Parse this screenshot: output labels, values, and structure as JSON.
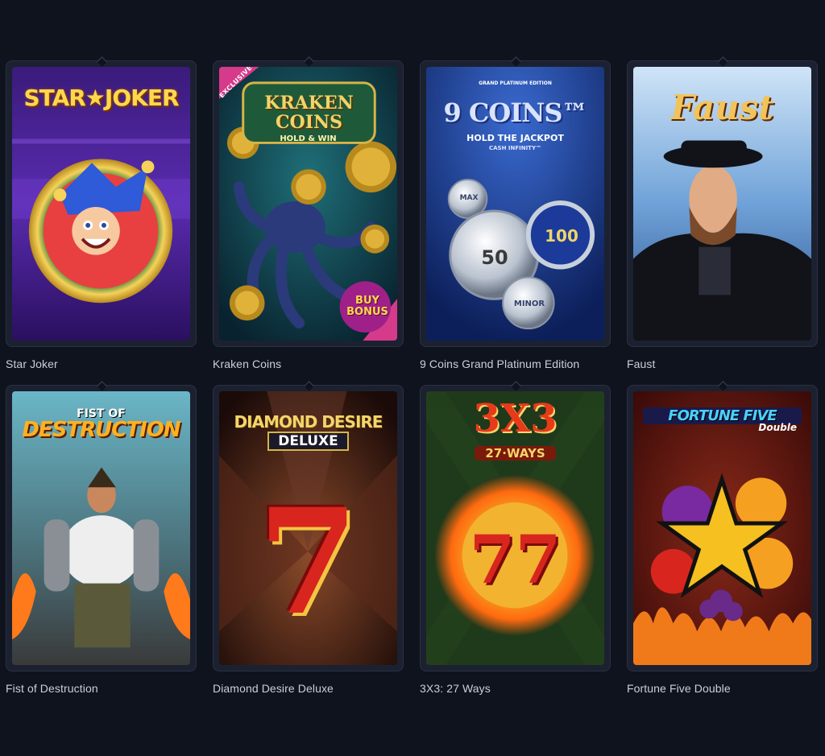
{
  "games": [
    {
      "title": "Star Joker",
      "logo_text": "STAR★JOKER",
      "icon": "jester-icon"
    },
    {
      "title": "Kraken Coins",
      "logo_text": "KRAKEN COINS",
      "logo_sub": "HOLD & WIN",
      "badge": "EXCLUSIVE",
      "bonus_text": "BUY BONUS",
      "icon": "octopus-icon"
    },
    {
      "title": "9 Coins Grand Platinum Edition",
      "logo_top": "GRAND PLATINUM EDITION",
      "logo_text": "9 COINS™",
      "logo_sub": "HOLD THE JACKPOT",
      "logo_sub2": "CASH INFINITY™",
      "coin_values": [
        "MAX",
        "50",
        "100",
        "MINOR"
      ],
      "icon": "coin-icon"
    },
    {
      "title": "Faust",
      "logo_text": "Faust",
      "icon": "portrait-icon"
    },
    {
      "title": "Fist of Destruction",
      "logo_top": "FIST OF",
      "logo_text": "DESTRUCTION",
      "icon": "fighter-icon"
    },
    {
      "title": "Diamond Desire Deluxe",
      "logo_text": "DIAMOND DESIRE",
      "logo_sub": "DELUXE",
      "symbol": "7",
      "icon": "seven-icon"
    },
    {
      "title": "3X3: 27 Ways",
      "logo_text": "3X3",
      "logo_sub": "27·WAYS",
      "symbol": "77",
      "icon": "fire-ring-icon"
    },
    {
      "title": "Fortune Five Double",
      "logo_text": "FORTUNE FIVE",
      "logo_sub": "Double",
      "icon": "star-fruit-icon"
    }
  ],
  "colors": {
    "background": "#0f131d",
    "card_frame": "#1b2130",
    "caption": "#c9cfdc"
  }
}
